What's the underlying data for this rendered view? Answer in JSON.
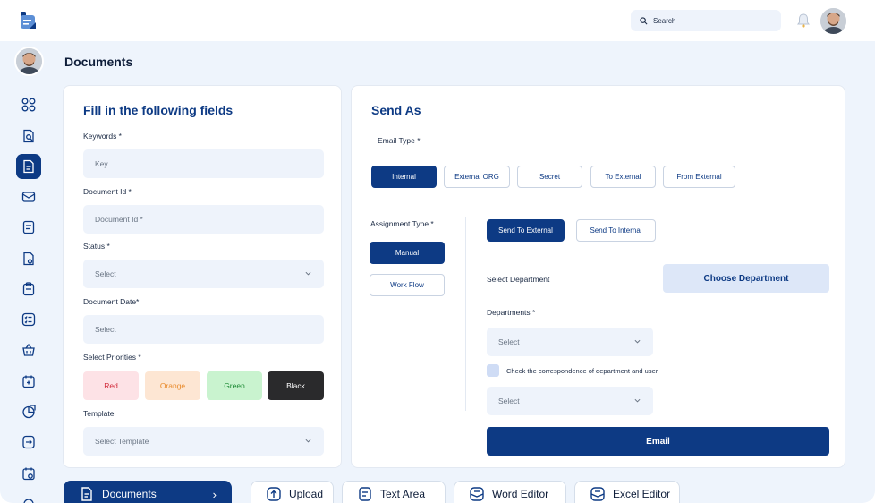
{
  "header": {
    "search_placeholder": "Search"
  },
  "page": {
    "title": "Documents"
  },
  "left_card": {
    "title": "Fill in the following fields",
    "keywords_label": "Keywords *",
    "keywords_placeholder": "Key",
    "doc_id_label": "Document Id *",
    "doc_id_placeholder": "Document Id *",
    "status_label": "Status *",
    "status_value": "Select",
    "doc_date_label": "Document Date*",
    "doc_date_value": "Select",
    "priorities_label": "Select Priorities *",
    "priorities": [
      "Red",
      "Orange",
      "Green",
      "Black"
    ],
    "template_label": "Template",
    "template_value": "Select Template"
  },
  "right_card": {
    "title": "Send As",
    "email_type_label": "Email Type *",
    "email_types": [
      "Internal",
      "External ORG",
      "Secret",
      "To External",
      "From External"
    ],
    "assignment_type_label": "Assignment Type *",
    "assignment_types": [
      "Manual",
      "Work Flow"
    ],
    "send_modes": [
      "Send To External",
      "Send To Internal"
    ],
    "select_department_label": "Select Department",
    "choose_department": "Choose Department",
    "departments_label": "Departments *",
    "departments_value": "Select",
    "check_label": "Check the correspondence of department and user",
    "second_select_value": "Select",
    "email_button": "Email"
  },
  "bottom_tabs": [
    {
      "label": "Documents",
      "chevron": "›"
    },
    {
      "label": "Upload"
    },
    {
      "label": "Text Area"
    },
    {
      "label": "Word Editor"
    },
    {
      "label": "Excel Editor"
    }
  ],
  "colors": {
    "primary": "#0d3a84",
    "background": "#eef4fc",
    "field": "#eef3fb",
    "red_bg": "#fde2e6",
    "red_text": "#d22b3b",
    "orange_bg": "#fde6d3",
    "orange_text": "#e98a2b",
    "green_bg": "#c9f3cf",
    "green_text": "#1d8a35",
    "black_bg": "#2a2a2c"
  }
}
